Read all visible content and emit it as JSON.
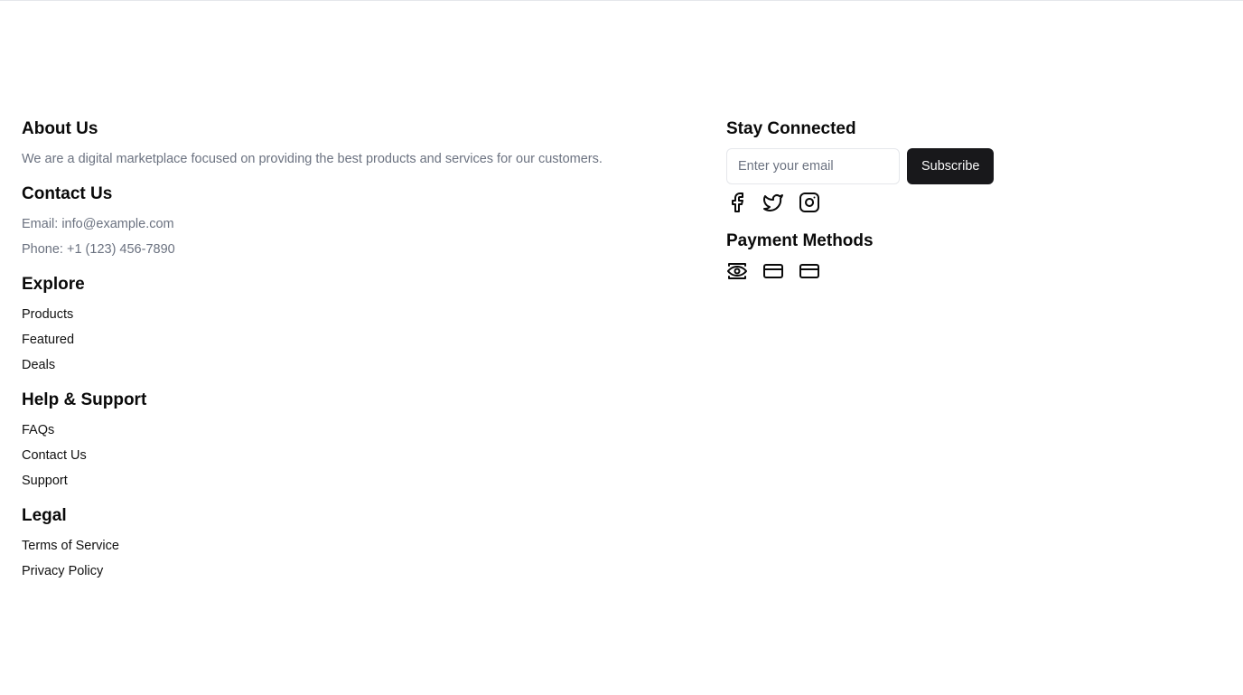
{
  "about": {
    "title": "About Us",
    "text": "We are a digital marketplace focused on providing the best products and services for our customers."
  },
  "contact": {
    "title": "Contact Us",
    "email": "Email: info@example.com",
    "phone": "Phone: +1 (123) 456-7890"
  },
  "explore": {
    "title": "Explore",
    "links": [
      "Products",
      "Featured",
      "Deals"
    ]
  },
  "help": {
    "title": "Help & Support",
    "links": [
      "FAQs",
      "Contact Us",
      "Support"
    ]
  },
  "legal": {
    "title": "Legal",
    "links": [
      "Terms of Service",
      "Privacy Policy"
    ]
  },
  "stay_connected": {
    "title": "Stay Connected",
    "email_placeholder": "Enter your email",
    "email_value": "",
    "subscribe_label": "Subscribe",
    "social_icons": [
      "facebook-icon",
      "twitter-icon",
      "instagram-icon"
    ]
  },
  "payment": {
    "title": "Payment Methods",
    "icons": [
      "eye-icon",
      "credit-card-icon",
      "credit-card-icon"
    ]
  },
  "colors": {
    "text": "#0a0a0a",
    "muted": "#6b7280",
    "button_bg": "#18181b",
    "button_text": "#fafafa",
    "border": "#e5e7eb"
  }
}
